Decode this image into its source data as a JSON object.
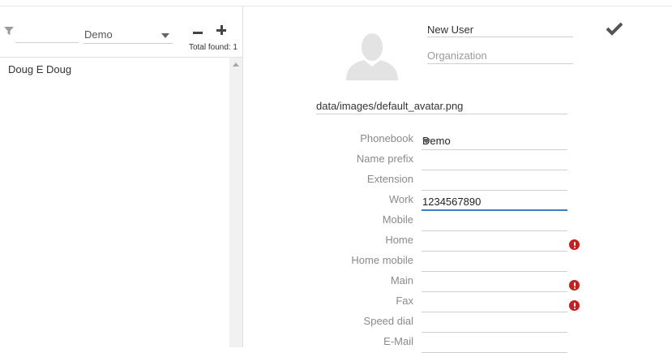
{
  "list_pane": {
    "filter_value": "",
    "phonebook_value": "Demo",
    "total_found": "Total found: 1",
    "contacts": [
      "Doug E Doug"
    ]
  },
  "editor": {
    "display_name": "New User",
    "organization_placeholder": "Organization",
    "avatar_path": "data/images/default_avatar.png",
    "fields": {
      "phonebook": {
        "label": "Phonebook",
        "value": "Demo"
      },
      "name_prefix": {
        "label": "Name prefix",
        "value": ""
      },
      "extension": {
        "label": "Extension",
        "value": ""
      },
      "work": {
        "label": "Work",
        "value": "1234567890"
      },
      "mobile": {
        "label": "Mobile",
        "value": ""
      },
      "home": {
        "label": "Home",
        "value": ""
      },
      "home_mobile": {
        "label": "Home mobile",
        "value": ""
      },
      "main": {
        "label": "Main",
        "value": ""
      },
      "fax": {
        "label": "Fax",
        "value": ""
      },
      "speed_dial": {
        "label": "Speed dial",
        "value": ""
      },
      "email": {
        "label": "E-Mail",
        "value": ""
      }
    }
  },
  "icons": {
    "filter": "filter-icon",
    "remove": "minus-icon",
    "add": "plus-icon",
    "save": "checkmark-icon",
    "warning": "error-icon",
    "avatar": "person-silhouette-icon"
  },
  "colors": {
    "focus_underline": "#3f7cc2",
    "warning": "#c81e1e",
    "label": "#8a8a8a"
  }
}
